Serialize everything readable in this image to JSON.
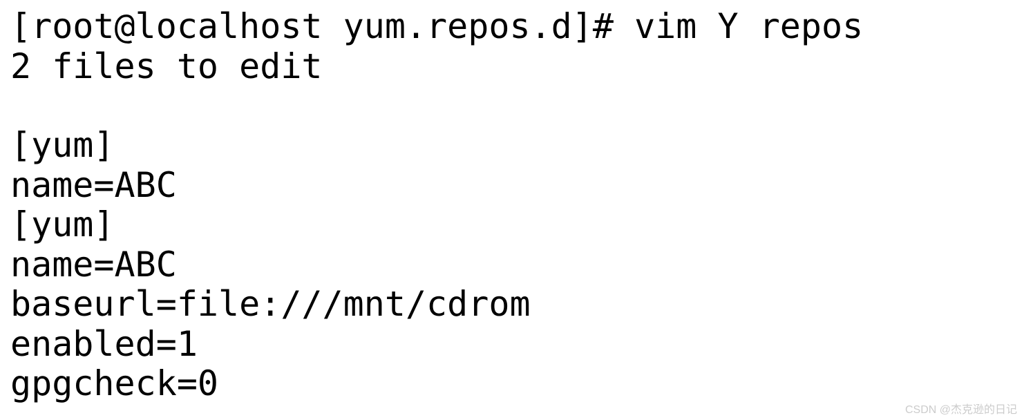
{
  "terminal": {
    "lines": [
      "[root@localhost yum.repos.d]# vim Y repos",
      "2 files to edit",
      "",
      "[yum]",
      "name=ABC",
      "[yum]",
      "name=ABC",
      "baseurl=file:///mnt/cdrom",
      "enabled=1",
      "gpgcheck=0"
    ]
  },
  "watermark": "CSDN @杰克逊的日记"
}
